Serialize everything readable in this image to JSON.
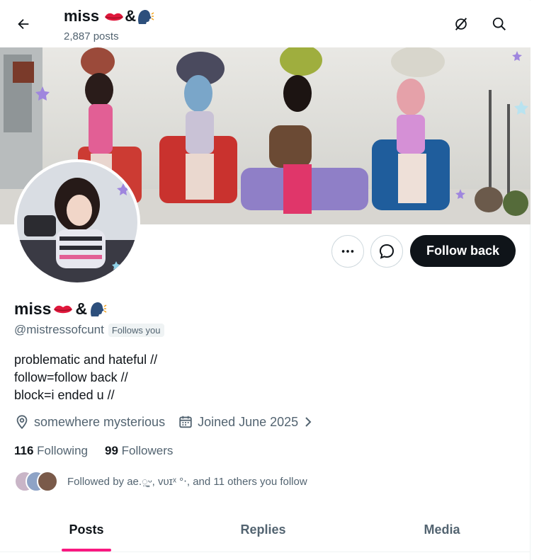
{
  "header": {
    "name": "miss",
    "name_suffix": "&",
    "posts_count": "2,887",
    "posts_label": "posts"
  },
  "profile": {
    "name": "miss",
    "name_suffix": "&",
    "handle": "@mistressofcunt",
    "follows_you_badge": "Follows you",
    "bio_lines": [
      "problematic and hateful //",
      "follow=follow back //",
      "block=i ended u //"
    ],
    "location": "somewhere mysterious",
    "joined": "Joined June 2025",
    "following_count": "116",
    "following_label": "Following",
    "followers_count": "99",
    "followers_label": "Followers",
    "followed_by_text": "Followed by ae.◌̤̳ᵕ, ᴠᴜɪˣ °‧, and 11 others you follow"
  },
  "actions": {
    "follow_back_label": "Follow back",
    "more_icon": "more-icon",
    "message_icon": "message-icon"
  },
  "tabs": [
    {
      "label": "Posts",
      "active": true
    },
    {
      "label": "Replies",
      "active": false
    },
    {
      "label": "Media",
      "active": false
    }
  ],
  "colors": {
    "accent": "#f91880",
    "text_primary": "#0f1419",
    "text_secondary": "#536471",
    "button_dark": "#0f1419"
  },
  "icons": {
    "back": "arrow-left-icon",
    "grok": "grok-icon",
    "search": "search-icon",
    "location": "location-pin-icon",
    "calendar": "calendar-icon"
  }
}
